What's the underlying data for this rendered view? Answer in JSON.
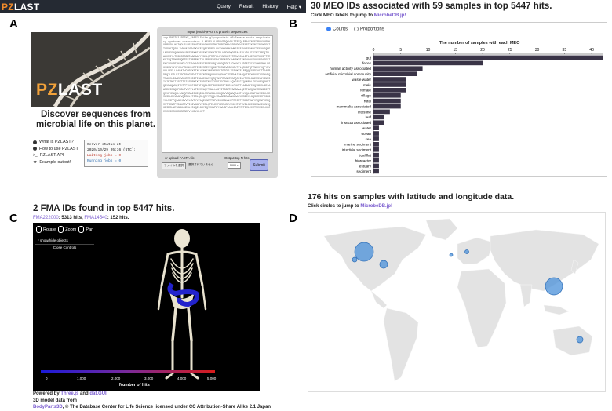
{
  "panels": {
    "a": "A",
    "b": "B",
    "c": "C",
    "d": "D"
  },
  "nav": {
    "brand_pz": "PZ",
    "brand_rest": "LAST",
    "menu": [
      "Query",
      "Result",
      "History",
      "Help ▾"
    ]
  },
  "panel_a": {
    "logo_pz": "PZ",
    "logo_rest": "LAST",
    "tagline": "Discover sequences from microbial life on this planet.",
    "links": [
      "What is PZLAST?",
      "How to use PZLAST",
      "PZLAST API",
      "Example output!"
    ],
    "status_lines": [
      "Server status at",
      "2020/10/29 05:36 (UTC):",
      "Waiting jobs = 0",
      "Running jobs = 0"
    ],
    "input_label": "Input (Multi-)FASTA protein sequences",
    "sequence_text": ">sp|P0DTC2|SPIKE_SARS2 Spike glycoprotein OS=Severe acute respiratory syndrome coronavirus 2 MFVFLVLLPLVSSQCVNLTTRTQLPPAYTNSFTRGVYYPDKVFRSSVLHSTQDLFLPFFSNVTWFHAIHVSGTNGTKRFDNPVLPFNDGVYFASTEKSNIIRGWIFGTTLDSKTQSLLIVNNATNVVIKVCEFQFCNDPFLGVYYHKNNKSWMESEFRVYSSANNCTFEYVSQPFLMDLEGKQGNFKNLREFVFKNIDGYFKIYSKHTPINLVRDLPQGFSALEPLVDLPIGINITRFQTLLALHRSYLTPGDSSSGWTAGAAAYYVGYLQPRTFLLKYNENGTITDAVDCALDPLSETKCTLKSFTVEKGIYQTSNFRVQPTESIVRFPNITNLCPFGEVFNATRFASVYAWNRKRISNCVADYSVLYNSASFSTFKCYGVSPTKLNDLCFTNVYADSFVIRGDEVRQIAPGQTGKIADYNYKLPDDFTGCVIAWNSNNLDSKVGGNYNYLYRLFRKSNLKPFERDISTEIYQAGSTPCNGVEGFNCYFPLQSYGFQPTNGVGYQPYRVVVLSFELLHAPATVCGPKKSTNLVKNKCVNFNFNGLTGTGVLTESNKKFLPFQQFGRDIADTTDAVRDPQTLEILDITPCSFGGVSVITPGTNTSNQVAVLYQDVNCTEVPVAIHADQLTPTWRVYSTGSNVFQTRAGCLIGAEHVNNSYECDIPIGAGICASYQTQTNSPRRARSVASQSIIAYTMSLGAENSVAYSNNSIAIPTNFTISVTTEILPVSMTKTSVDCTMYICGDSTECSNLLLQYGSFCTQLNRALTGIAVEQDKNTQEVFAQVKQIYKTPPIKDFGGFNFSQILPDPSKPSKRSFIEDLLFNKVTLADAGFIKQYGDCLGDIAARDLICAQKFNGLTVLPPLLTDEMIAQYTSALLAGTITSGWTFGAGAALQIPFAMQMAYRFNGIGVTQNVLYENQKLIANQFNSAIGKIQDSLSSTASALGKLQDVVNQNAQALNTLVKQLSSNFGAISSVLNDILSRLDKVEAEVQIDRLITGRLQSLQTYVTQQLIRAAEIRASANLAATKMSECVLGQSKRVDFCGKGYHLMSFPQSAPHGVVFLHVTYVPAQEKNFTTAPAICHDGKAHFPREGVFVSNGTHWFVTQRNFYEPQIITTDNTFVSGNCDVVIGIVNNTVYDPLQPELDSFKEELDKYFKNHTSPDVDLGDISGINASVVNIQKEIDRLNEVAKNLNESLIDLQELGKYEQYIKWPWYIWLGFIAGLIAIVMVTIMLCCMTSCCSCLKGCCSCGSCCKFDEDDSEPVLKGVKLHYT",
    "upload_label": "or upload FASTA file",
    "choose_file_label": "ファイルを選択",
    "no_file_label": "選択されていません",
    "output_label": "Output top N hits",
    "output_value": "5000",
    "submit_label": "Submit"
  },
  "panel_b": {
    "title": "30 MEO IDs associated with 59 samples in top 5447 hits.",
    "subtitle_prefix": "Click MEO labels to jump to ",
    "subtitle_link": "MicrobeDB.jp!",
    "radio_counts": "Counts",
    "radio_proportions": "Proportions"
  },
  "chart_data": {
    "type": "bar",
    "orientation": "horizontal",
    "title": "The number of samples with each MEO",
    "categories": [
      "gut",
      "feces",
      "human activity associated",
      "artificial microbial community",
      "waste water",
      "male",
      "female",
      "village",
      "rural",
      "mammalia associated",
      "intestine",
      "leaf",
      "insecta associated",
      "water",
      "ocean",
      "sea",
      "marine sediment",
      "intertidal sediment",
      "tidal flat",
      "bioreactor",
      "estuary",
      "sediment"
    ],
    "values": [
      42,
      20,
      9,
      8,
      6,
      6,
      6,
      5,
      5,
      5,
      3,
      2,
      2,
      1,
      1,
      1,
      1,
      1,
      1,
      1,
      1,
      1
    ],
    "xlim": [
      0,
      42
    ],
    "xticks": [
      0,
      5,
      10,
      15,
      20,
      25,
      30,
      35,
      40
    ],
    "bar_color": "#3a3447"
  },
  "panel_c": {
    "title": "2 FMA IDs found in top 5447 hits.",
    "sub_link1": "FMA222000",
    "sub_text1": ": 5313 hits,",
    "sub_link2": "FMA14540",
    "sub_text2": ": 152 hits.",
    "ctrl_rotate": "Rotate",
    "ctrl_zoom": "Zoom",
    "ctrl_pan": "Pan",
    "show_hide": "* show/hide objects",
    "close_controls": "Close Controls",
    "scale_ticks": [
      "0",
      "1,000",
      "2,000",
      "3,000",
      "4,000",
      "5,000"
    ],
    "scale_label": "Number of hits",
    "powered_prefix": "Powered by ",
    "powered_link1": "Three.js",
    "powered_mid": " and ",
    "powered_link2": "dat.GUI",
    "powered_end": ".",
    "model_line": "3D model data from",
    "credit_link": "BodyParts3D",
    "credit_text": ", © The Database Center for Life Science licensed under CC Attribution-Share Alike 2.1 Japan"
  },
  "panel_d": {
    "title": "176 hits on samples with latitude and longitude data.",
    "sub_prefix": "Click circles to jump to ",
    "sub_link": "MicrobeDB.jp!"
  }
}
